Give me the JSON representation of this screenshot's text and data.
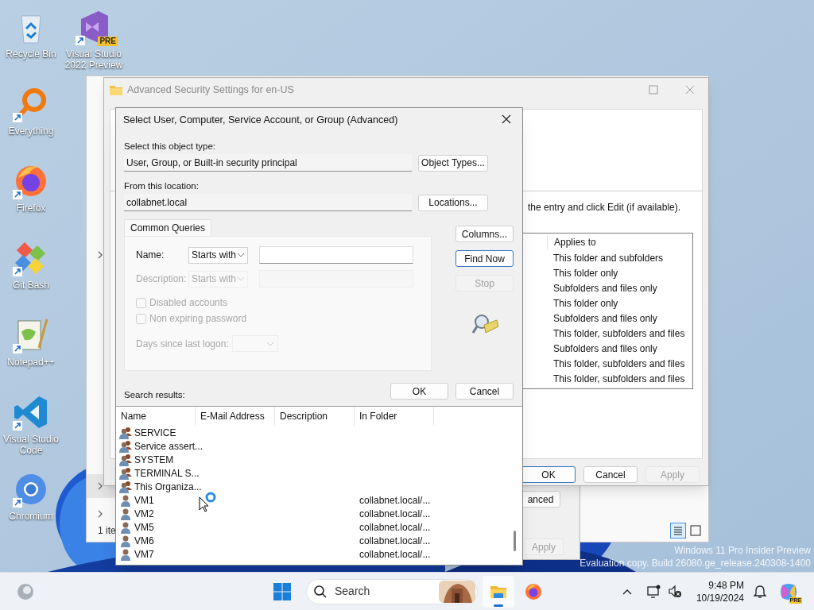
{
  "desktop_icons": [
    {
      "label": "Recycle Bin",
      "kind": "recycle_bin",
      "shortcut": false
    },
    {
      "label": "Everything",
      "kind": "everything",
      "shortcut": true
    },
    {
      "label": "Firefox",
      "kind": "firefox",
      "shortcut": true
    },
    {
      "label": "Git Bash",
      "kind": "git_bash",
      "shortcut": true
    },
    {
      "label": "Notepad++",
      "kind": "notepad",
      "shortcut": true
    },
    {
      "label": "Visual Studio Code",
      "kind": "vscode",
      "shortcut": true
    },
    {
      "label": "Chromium",
      "kind": "chromium",
      "shortcut": true
    }
  ],
  "desktop_icons_column_2": [
    {
      "label": "Visual Studio 2022 Preview",
      "kind": "visual_studio",
      "shortcut": true,
      "badge": "PRE"
    }
  ],
  "explorer_window": {
    "status_text": "1 ite"
  },
  "properties_window": {
    "buttons": [
      {
        "label": "anced",
        "disabled": false
      },
      {
        "label": "Apply",
        "disabled": true
      }
    ]
  },
  "advanced_security_window": {
    "title": "Advanced Security Settings for en-US",
    "instruction": "the entry and click Edit (if available).",
    "permission_table": {
      "columns": [
        "Applies to"
      ],
      "rows": [
        "This folder and subfolders",
        "This folder only",
        "Subfolders and files only",
        "This folder only",
        "Subfolders and files only",
        "This folder, subfolders and files",
        "Subfolders and files only",
        "This folder, subfolders and files",
        "This folder, subfolders and files"
      ]
    },
    "buttons": [
      {
        "label": "OK",
        "disabled": false,
        "focused": true
      },
      {
        "label": "Cancel",
        "disabled": false,
        "focused": false
      },
      {
        "label": "Apply",
        "disabled": true,
        "focused": false
      }
    ]
  },
  "select_dialog": {
    "title": "Select User, Computer, Service Account, or Group (Advanced)",
    "object_type": {
      "label": "Select this object type:",
      "value": "User, Group, or Built-in security principal",
      "button": "Object Types..."
    },
    "location": {
      "label": "From this location:",
      "value": "collabnet.local",
      "button": "Locations..."
    },
    "tabs": [
      {
        "label": "Common Queries",
        "selected": true
      }
    ],
    "queries": [
      {
        "label": "Name:",
        "match": "Starts with",
        "disabled": false
      },
      {
        "label": "Description:",
        "match": "Starts with",
        "disabled": true
      }
    ],
    "checkboxes": [
      {
        "label": "Disabled accounts",
        "checked": false,
        "disabled": true
      },
      {
        "label": "Non expiring password",
        "checked": false,
        "disabled": true
      }
    ],
    "days_since_last_logon": {
      "label": "Days since last logon:",
      "disabled": true
    },
    "side_buttons": [
      {
        "label": "Columns...",
        "disabled": false,
        "focused": false
      },
      {
        "label": "Find Now",
        "disabled": false,
        "focused": true
      },
      {
        "label": "Stop",
        "disabled": true,
        "focused": false
      }
    ],
    "buttons": [
      "OK",
      "Cancel"
    ],
    "results_label": "Search results:",
    "results": {
      "columns": [
        "Name",
        "E-Mail Address",
        "Description",
        "In Folder"
      ],
      "rows": [
        {
          "kind": "group",
          "name": "SERVICE"
        },
        {
          "kind": "group",
          "name": "Service assert..."
        },
        {
          "kind": "group",
          "name": "SYSTEM"
        },
        {
          "kind": "group",
          "name": "TERMINAL S..."
        },
        {
          "kind": "group",
          "name": "This Organiza..."
        },
        {
          "kind": "user",
          "name": "VM1",
          "in_folder": "collabnet.local/..."
        },
        {
          "kind": "user",
          "name": "VM2",
          "in_folder": "collabnet.local/..."
        },
        {
          "kind": "user",
          "name": "VM5",
          "in_folder": "collabnet.local/..."
        },
        {
          "kind": "user",
          "name": "VM6",
          "in_folder": "collabnet.local/..."
        },
        {
          "kind": "user",
          "name": "VM7",
          "in_folder": "collabnet.local/..."
        }
      ]
    }
  },
  "taskbar": {
    "search_placeholder": "Search",
    "apps": [
      {
        "kind": "file_explorer",
        "selected": true
      },
      {
        "kind": "firefox",
        "selected": false
      }
    ],
    "time": "9:48 PM",
    "date": "10/19/2024",
    "copilot_badge": "PRE"
  },
  "watermark": [
    "Windows 11 Pro Insider Preview",
    "Evaluation copy. Build 26080.ge_release.240308-1400"
  ]
}
